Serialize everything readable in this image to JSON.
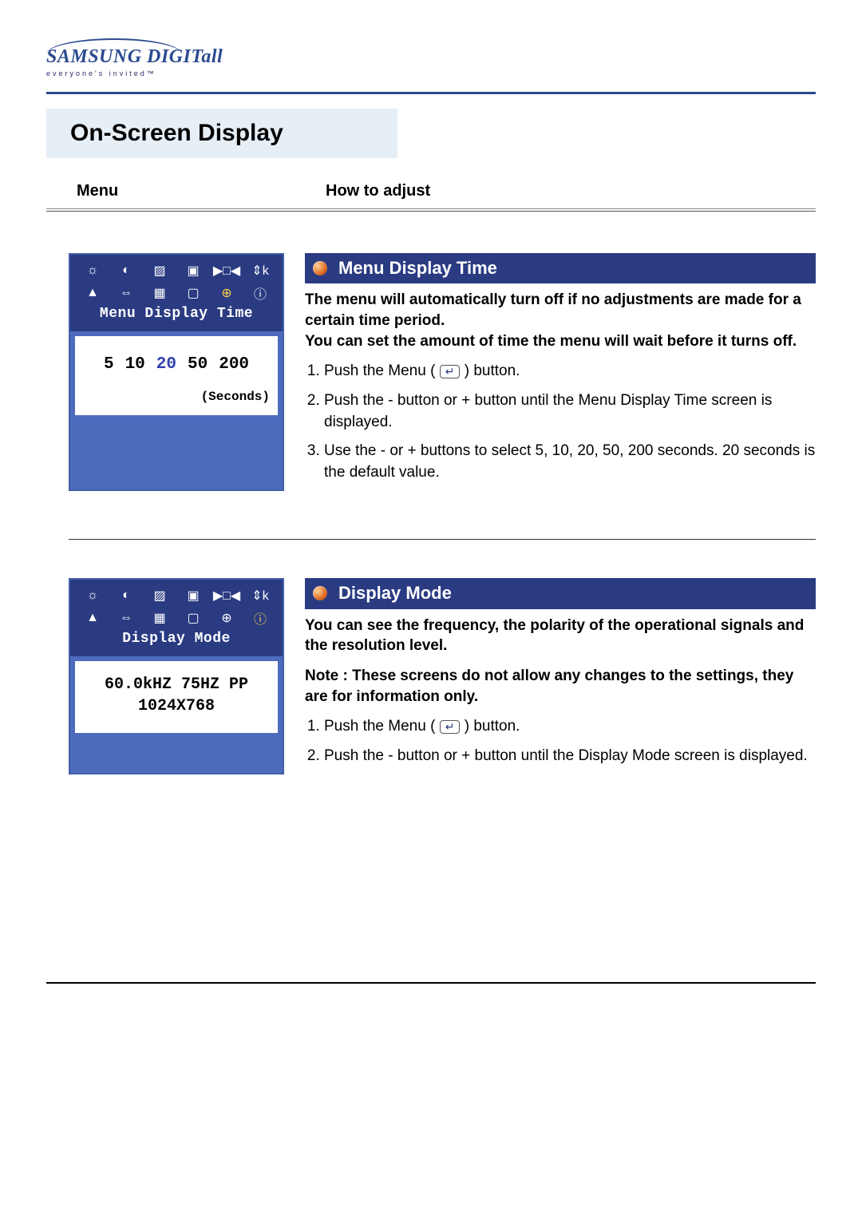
{
  "logo": {
    "brand": "SAMSUNG DIGITall",
    "tagline": "everyone's invited™"
  },
  "page_title": "On-Screen Display",
  "col_headers": {
    "col1": "Menu",
    "col2": "How to adjust"
  },
  "sections": [
    {
      "osd": {
        "title": "Menu Display Time",
        "time_values": [
          "5",
          "10",
          "20",
          "50",
          "200"
        ],
        "selected_value": "20",
        "unit_label": "(Seconds)",
        "icons_row1": [
          "☼",
          "◐",
          "▨",
          "▣",
          "▶□◀",
          "⇕k"
        ],
        "icons_row2": [
          "▲",
          "⇔",
          "▦",
          "▢",
          "⊕",
          "ⓘ"
        ],
        "highlight_index": 10
      },
      "heading": "Menu Display Time",
      "intro": "The menu will automatically turn off if no adjustments are made for a certain time period.\nYou can set the amount of time the menu will wait before it turns off.",
      "steps": [
        {
          "pre": "Push the Menu (",
          "post": ") button.",
          "has_button": true
        },
        {
          "text": "Push the - button or + button until the Menu Display Time screen is displayed."
        },
        {
          "text": "Use the - or + buttons to select 5, 10, 20, 50, 200 seconds. 20 seconds is the default value."
        }
      ]
    },
    {
      "osd": {
        "title": "Display Mode",
        "mode_line1": "60.0kHZ 75HZ PP",
        "mode_line2": "1024X768",
        "icons_row1": [
          "☼",
          "◐",
          "▨",
          "▣",
          "▶□◀",
          "⇕k"
        ],
        "icons_row2": [
          "▲",
          "⇔",
          "▦",
          "▢",
          "⊕",
          "ⓘ"
        ],
        "highlight_index": 11
      },
      "heading": "Display Mode",
      "intro": "You can see the frequency, the polarity of the operational signals and the resolution level.",
      "note": "Note :  These screens do not allow any changes to the settings, they are for information only.",
      "steps": [
        {
          "pre": "Push the Menu (",
          "post": ") button.",
          "has_button": true
        },
        {
          "text": "Push the - button or + button until the Display Mode screen is displayed."
        }
      ]
    }
  ],
  "menu_button_glyph": "↵"
}
